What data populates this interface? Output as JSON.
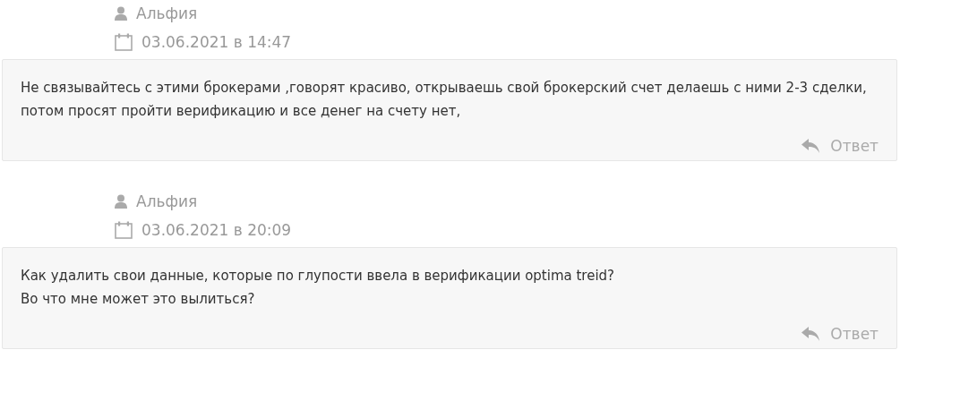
{
  "comments": [
    {
      "author": "Альфия",
      "date": "03.06.2021 в 14:47",
      "paragraphs": [
        "Не связывайтесь с этими брокерами ,говорят красиво, открываешь свой брокерский счет делаешь с ними 2-3 сделки, потом просят пройти верификацию и все денег на счету нет,"
      ],
      "reply": "Ответ"
    },
    {
      "author": "Альфия",
      "date": "03.06.2021 в 20:09",
      "paragraphs": [
        "Как удалить свои данные, которые по глупости ввела в верификации optima treid?",
        "Во что мне может это вылиться?"
      ],
      "reply": "Ответ"
    }
  ]
}
